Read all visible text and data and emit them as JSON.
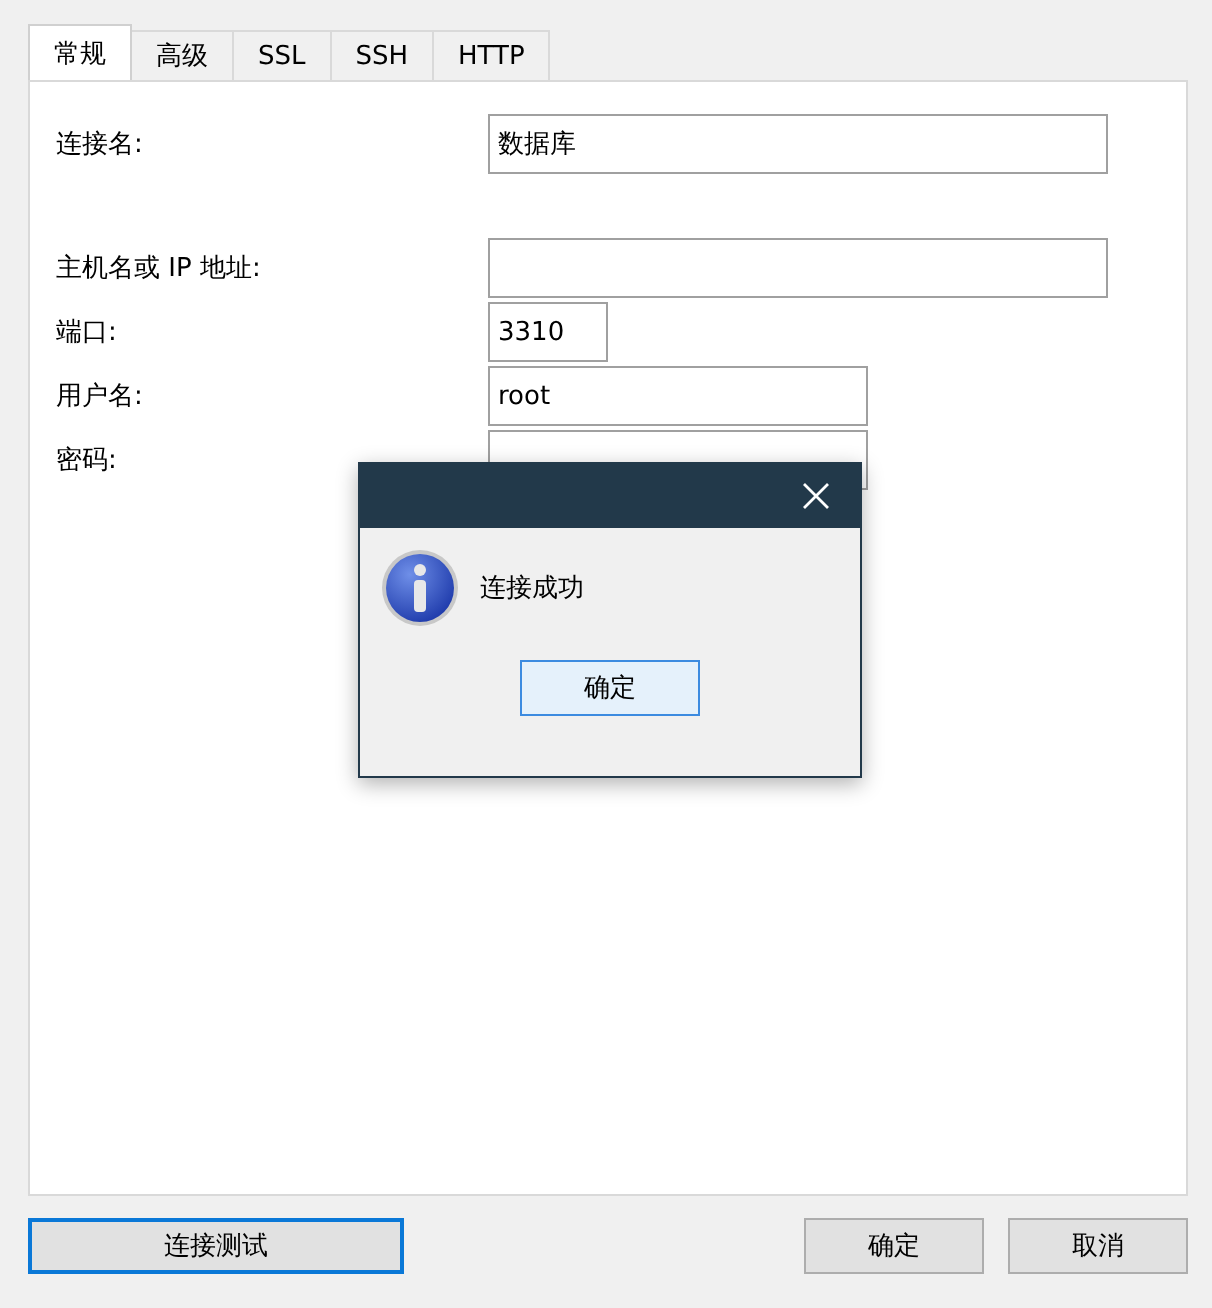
{
  "tabs": [
    {
      "label": "常规",
      "selected": true
    },
    {
      "label": "高级",
      "selected": false
    },
    {
      "label": "SSL",
      "selected": false
    },
    {
      "label": "SSH",
      "selected": false
    },
    {
      "label": "HTTP",
      "selected": false
    }
  ],
  "fields": [
    {
      "label": "连接名:",
      "value": "数据库"
    },
    {
      "label": "主机名或 IP 地址:"
    },
    {
      "label": "端口:",
      "value": "3310"
    },
    {
      "label": "用户名:",
      "value": "root"
    },
    {
      "label": "密码:"
    }
  ],
  "dialog": {
    "message": "连接成功",
    "ok_button": "确定"
  },
  "buttons": {
    "test": "连接测试",
    "ok": "确定",
    "cancel": "取消"
  }
}
